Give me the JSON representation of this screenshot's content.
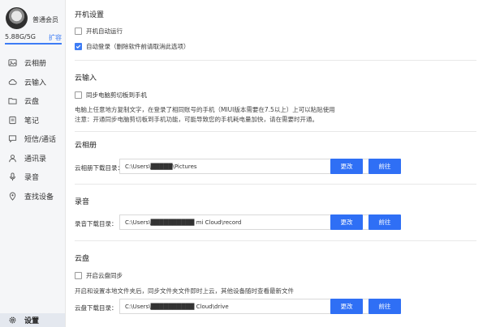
{
  "sidebar": {
    "user_level": "普通会员",
    "storage_text": "5.88G/5G",
    "storage_used_fraction": 1.0,
    "expand_label": "扩容",
    "items": [
      {
        "label": "云相册",
        "icon": "photo-album-icon"
      },
      {
        "label": "云输入",
        "icon": "cloud-input-icon"
      },
      {
        "label": "云盘",
        "icon": "folder-icon"
      },
      {
        "label": "笔记",
        "icon": "note-icon"
      },
      {
        "label": "短信/通话",
        "icon": "message-icon"
      },
      {
        "label": "通讯录",
        "icon": "contacts-icon"
      },
      {
        "label": "录音",
        "icon": "microphone-icon"
      },
      {
        "label": "查找设备",
        "icon": "location-icon"
      }
    ],
    "settings_label": "设置"
  },
  "startup": {
    "title": "开机设置",
    "auto_run_label": "开机自动运行",
    "auto_run_checked": false,
    "auto_login_label": "自动登录（删除软件前请取消此选项）",
    "auto_login_checked": true
  },
  "cloud_input": {
    "title": "云输入",
    "sync_label": "同步电脑剪切板到手机",
    "sync_checked": false,
    "desc1": "电脑上任意地方复制文字，在登录了相同账号的手机（MIUI版本需要在7.5以上）上可以粘贴使用",
    "desc2": "注意：开通同步电脑剪切板到手机功能，可能导致您的手机耗电量加快，请在需要时开通。"
  },
  "album": {
    "title": "云相册",
    "path_label": "云相册下载目录：",
    "path_value": "C:\\Users\\█████\\Pictures",
    "change_label": "更改",
    "goto_label": "前往"
  },
  "recording": {
    "title": "录音",
    "path_label": "录音下载目录：",
    "path_value": "C:\\Users\\██████████ mi Cloud\\record",
    "change_label": "更改",
    "goto_label": "前往"
  },
  "drive": {
    "title": "云盘",
    "sync_label": "开启云盘同步",
    "sync_checked": false,
    "desc": "开启和设置本地文件夹后，同步文件夹文件即时上云，其他设备随时查看最新文件",
    "path_label": "云盘下载目录：",
    "path_value": "C:\\Users\\██████████ Cloud\\drive",
    "change_label": "更改",
    "goto_label": "前往"
  },
  "colors": {
    "accent": "#2f6ff5",
    "link": "#3d7cf5",
    "sidebar_bg": "#f5f6f8"
  }
}
